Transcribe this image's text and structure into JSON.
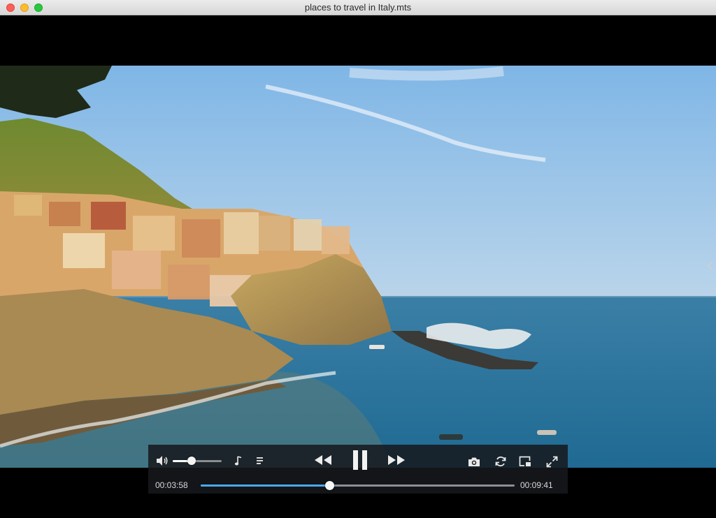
{
  "window": {
    "title": "places to travel in Italy.mts"
  },
  "player": {
    "current_time": "00:03:58",
    "total_time": "00:09:41",
    "progress_fraction": 0.41,
    "volume_fraction": 0.38,
    "state": "playing"
  },
  "icons": {
    "volume": "volume-icon",
    "audio_track": "music-note-icon",
    "playlist": "playlist-icon",
    "rewind": "rewind-icon",
    "pause": "pause-icon",
    "fast_forward": "fast-forward-icon",
    "snapshot": "camera-icon",
    "loop": "loop-icon",
    "pip": "picture-in-picture-icon",
    "fullscreen": "fullscreen-icon"
  },
  "colors": {
    "progress_accent": "#4aa9f0",
    "controls_bg": "#16181c",
    "icon": "#e8e8e8"
  }
}
